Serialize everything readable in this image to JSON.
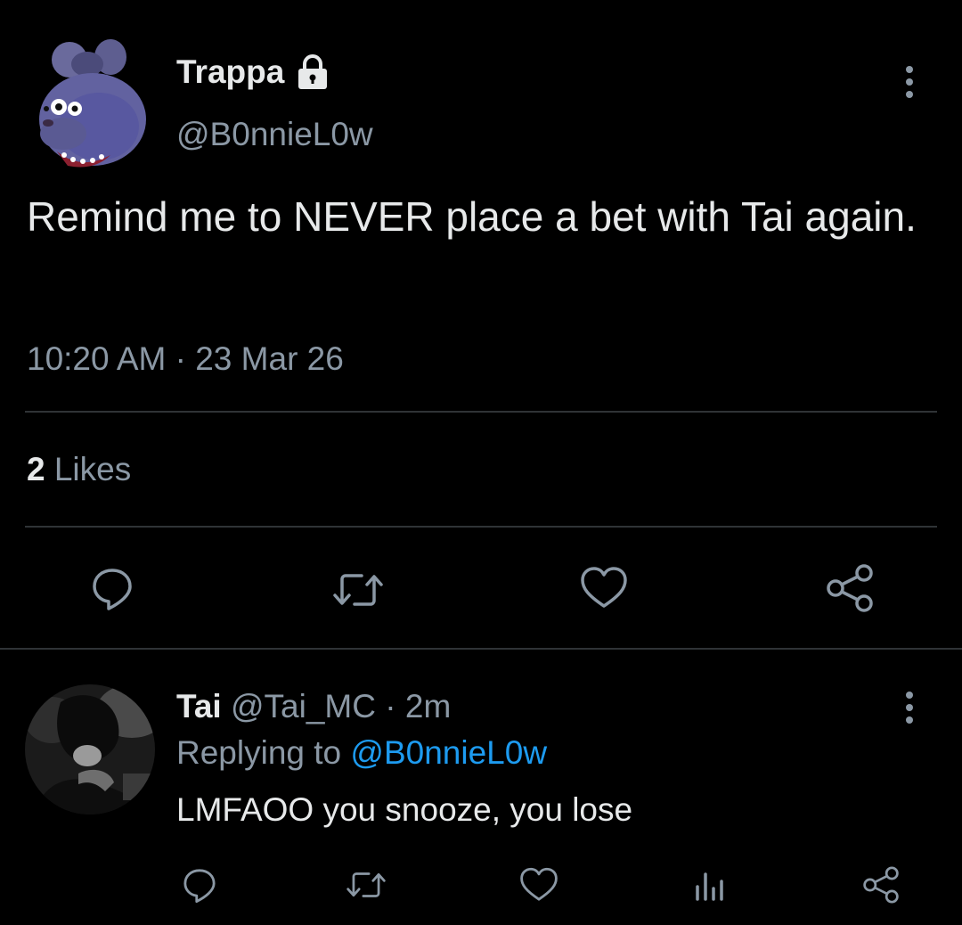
{
  "main_tweet": {
    "display_name": "Trappa",
    "handle": "@B0nnieL0w",
    "text": "Remind me to NEVER place a bet with Tai again.",
    "time": "10:20 AM",
    "separator": "·",
    "date": "23 Mar 26",
    "likes_count": "2",
    "likes_label": "Likes",
    "avatar_icon": "animatronic-bunny-avatar",
    "locked_icon": "lock-icon"
  },
  "reply": {
    "display_name": "Tai",
    "handle": "@Tai_MC",
    "separator": "·",
    "age": "2m",
    "replying_prefix": "Replying to",
    "replying_handle": "@B0nnieL0w",
    "text": "LMFAOO you snooze, you lose",
    "avatar_icon": "person-photo-avatar"
  },
  "colors": {
    "background": "#000000",
    "text_primary": "#e7e9ea",
    "text_secondary": "#8b98a5",
    "accent": "#1d9bf0",
    "divider": "#2f3336"
  }
}
